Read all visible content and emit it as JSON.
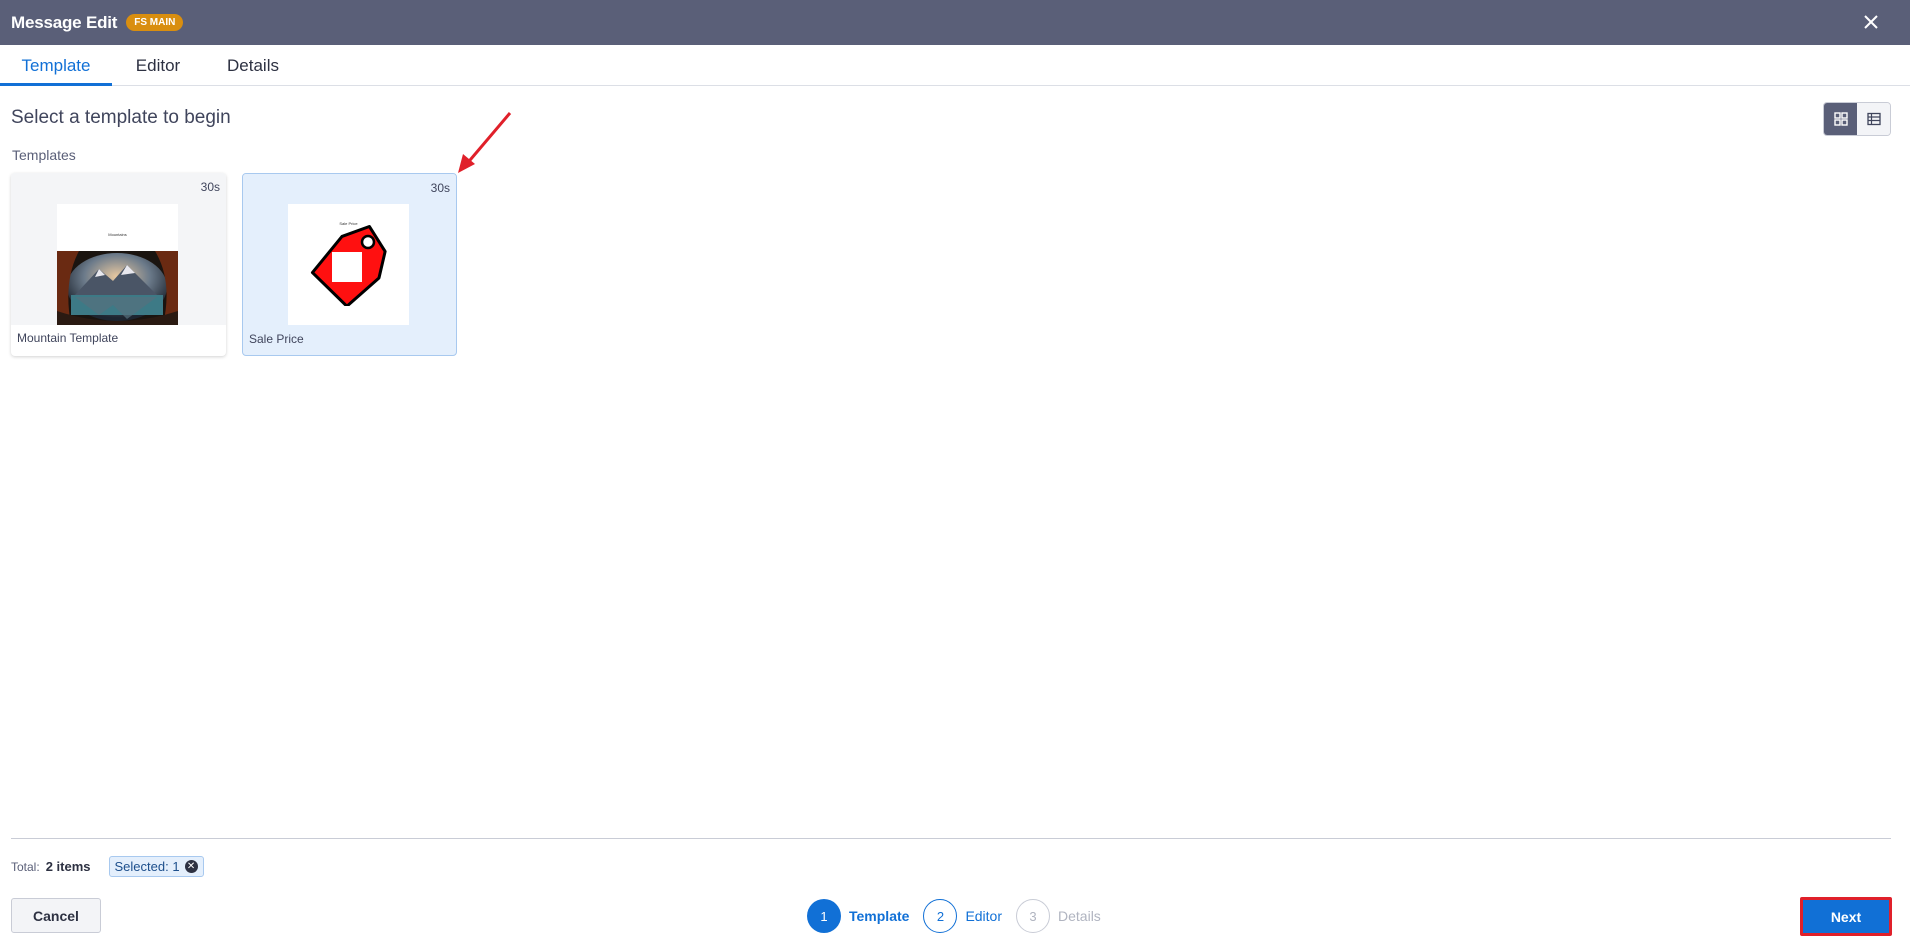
{
  "header": {
    "title": "Message Edit",
    "badge": "FS MAIN"
  },
  "tabs": [
    {
      "label": "Template"
    },
    {
      "label": "Editor"
    },
    {
      "label": "Details"
    }
  ],
  "main": {
    "heading": "Select a template to begin",
    "section_label": "Templates",
    "view_modes": {
      "selected": "grid"
    }
  },
  "templates": [
    {
      "name": "Mountain Template",
      "duration": "30s",
      "preview_caption": "Mountains",
      "selected": false
    },
    {
      "name": "Sale Price",
      "duration": "30s",
      "preview_caption": "Sale Price",
      "selected": true
    }
  ],
  "footer": {
    "total_label": "Total:",
    "total_value": "2 items",
    "selected_chip": "Selected: 1",
    "cancel_label": "Cancel",
    "next_label": "Next",
    "steps": [
      {
        "number": "1",
        "label": "Template"
      },
      {
        "number": "2",
        "label": "Editor"
      },
      {
        "number": "3",
        "label": "Details"
      }
    ]
  },
  "colors": {
    "header_bg": "#5a5f78",
    "accent": "#1170d6",
    "badge": "#d98e0f",
    "highlight_border": "#e0202a"
  }
}
